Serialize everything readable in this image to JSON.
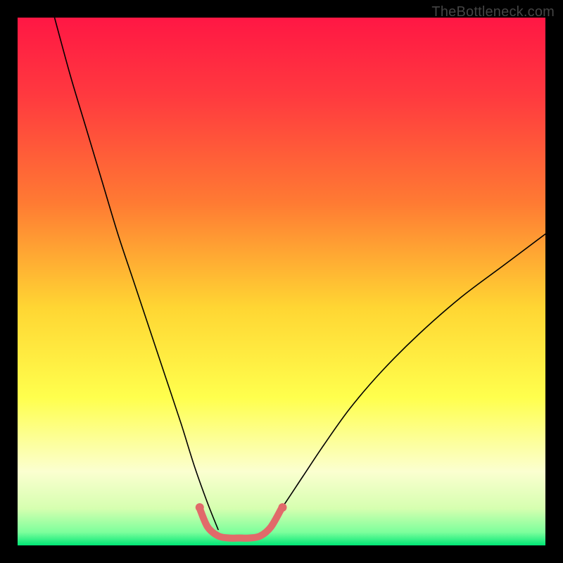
{
  "watermark": "TheBottleneck.com",
  "chart_data": {
    "type": "line",
    "title": "",
    "xlabel": "",
    "ylabel": "",
    "xlim": [
      0,
      100
    ],
    "ylim": [
      0,
      100
    ],
    "grid": false,
    "legend": false,
    "background_gradient": {
      "stops": [
        {
          "pos": 0.0,
          "color": "#ff1744"
        },
        {
          "pos": 0.15,
          "color": "#ff3a3f"
        },
        {
          "pos": 0.35,
          "color": "#ff7a33"
        },
        {
          "pos": 0.55,
          "color": "#ffd633"
        },
        {
          "pos": 0.72,
          "color": "#ffff4d"
        },
        {
          "pos": 0.86,
          "color": "#fbffd0"
        },
        {
          "pos": 0.93,
          "color": "#d6ffb0"
        },
        {
          "pos": 0.975,
          "color": "#7dff9c"
        },
        {
          "pos": 1.0,
          "color": "#00e676"
        }
      ]
    },
    "series": [
      {
        "name": "left-curve",
        "color": "#000000",
        "width": 1.6,
        "x": [
          7,
          10,
          13,
          16,
          19,
          22,
          25,
          28,
          31,
          33.5,
          36,
          38
        ],
        "y": [
          100,
          89,
          79,
          69,
          59,
          50,
          41,
          32,
          23,
          15,
          8,
          3
        ]
      },
      {
        "name": "right-curve",
        "color": "#000000",
        "width": 1.6,
        "x": [
          47,
          50,
          54,
          58,
          63,
          69,
          76,
          84,
          92,
          100
        ],
        "y": [
          3,
          7,
          13,
          19,
          26,
          33,
          40,
          47,
          53,
          59
        ]
      },
      {
        "name": "valley-band",
        "color": "#e16a6a",
        "width": 10,
        "x": [
          34.5,
          36,
          38,
          40,
          42,
          44,
          46,
          48,
          50
        ],
        "y": [
          7,
          3.5,
          1.8,
          1.4,
          1.4,
          1.4,
          1.8,
          3.5,
          7
        ]
      }
    ],
    "markers": [
      {
        "x": 34.5,
        "y": 7.2,
        "r": 6,
        "color": "#e16a6a"
      },
      {
        "x": 50.2,
        "y": 7.2,
        "r": 6,
        "color": "#e16a6a"
      }
    ]
  }
}
